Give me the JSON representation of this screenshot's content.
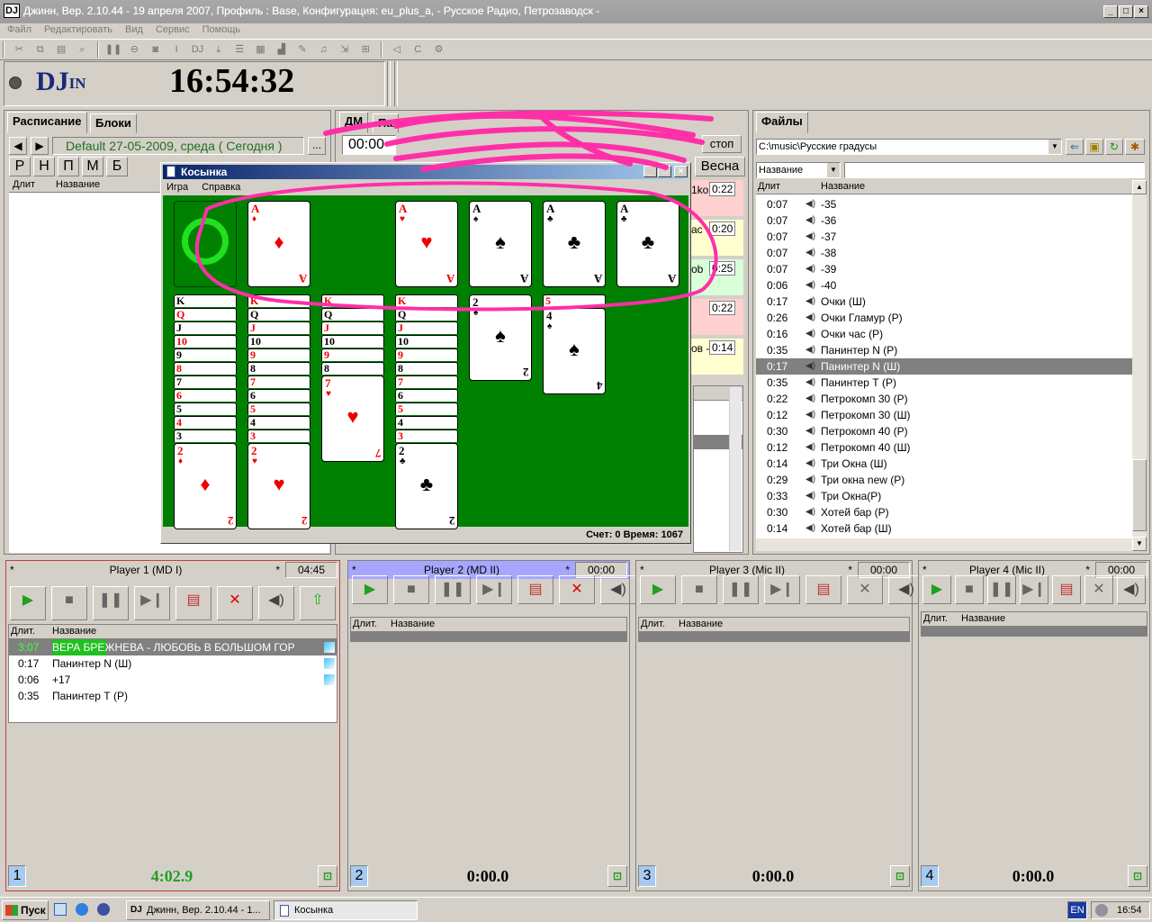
{
  "window": {
    "title": "Джинн, Вер. 2.10.44 - 19 апреля 2007, Профиль : Base, Конфигурация: eu_plus_a, - Русское Радио, Петрозаводск -",
    "app_icon": "DJ"
  },
  "menu": [
    "Файл",
    "Редактировать",
    "Вид",
    "Сервис",
    "Помощь"
  ],
  "header": {
    "logo": "DJ",
    "logo_suffix": "IN",
    "clock": "16:54:32"
  },
  "schedule": {
    "tabs": [
      "Расписание",
      "Блоки"
    ],
    "date_label": "Default 27-05-2009, среда ( Сегодня )",
    "more_button": "...",
    "letter_buttons": [
      "Р",
      "Н",
      "П",
      "М",
      "Б"
    ],
    "col_duration": "Длит",
    "col_name": "Название"
  },
  "middle": {
    "tab_dm": "ДМ",
    "tab_partial": "Па",
    "time_partial": "00:00",
    "stop_label": "стоп",
    "vesna_label": "Весна",
    "block_times": [
      "0:22",
      "0:20",
      "0:25",
      "0:22",
      "0:14"
    ],
    "block_partial": [
      "1ko",
      "ac",
      "ob",
      "",
      "ов -"
    ]
  },
  "files": {
    "tab": "Файлы",
    "path": "C:\\music\\Русские градусы",
    "sort_by": "Название",
    "col_duration": "Длит",
    "col_name": "Название",
    "rows": [
      {
        "d": "0:07",
        "n": "-35"
      },
      {
        "d": "0:07",
        "n": "-36"
      },
      {
        "d": "0:07",
        "n": "-37"
      },
      {
        "d": "0:07",
        "n": "-38"
      },
      {
        "d": "0:07",
        "n": "-39"
      },
      {
        "d": "0:06",
        "n": "-40"
      },
      {
        "d": "0:17",
        "n": "Очки (Ш)"
      },
      {
        "d": "0:26",
        "n": "Очки Гламур (Р)"
      },
      {
        "d": "0:16",
        "n": "Очки час (Р)"
      },
      {
        "d": "0:35",
        "n": "Панинтер N (Р)"
      },
      {
        "d": "0:17",
        "n": "Панинтер N (Ш)",
        "selected": true
      },
      {
        "d": "0:35",
        "n": "Панинтер Т (Р)"
      },
      {
        "d": "0:22",
        "n": "Петрокомп 30 (Р)"
      },
      {
        "d": "0:12",
        "n": "Петрокомп 30 (Ш)"
      },
      {
        "d": "0:30",
        "n": "Петрокомп 40 (Р)"
      },
      {
        "d": "0:12",
        "n": "Петрокомп 40 (Ш)"
      },
      {
        "d": "0:14",
        "n": "Три  Окна (Ш)"
      },
      {
        "d": "0:29",
        "n": "Три окна new (Р)"
      },
      {
        "d": "0:33",
        "n": "Три Окна(Р)"
      },
      {
        "d": "0:30",
        "n": "Хотей бар (Р)"
      },
      {
        "d": "0:14",
        "n": "Хотей бар (Ш)"
      }
    ]
  },
  "players": [
    {
      "num": "1",
      "title": "Player 1  (MD I)",
      "star": "*",
      "time": "04:45",
      "big_time": "4:02.9",
      "col_duration": "Длит.",
      "col_name": "Название",
      "rows": [
        {
          "d": "3:07",
          "n": "ВЕРА БРЕЖНЕВА - ЛЮБОВЬ В БОЛЬШОМ ГОР",
          "playing": true
        },
        {
          "d": "0:17",
          "n": "Панинтер N (Ш)"
        },
        {
          "d": "0:06",
          "n": "+17"
        },
        {
          "d": "0:35",
          "n": "Панинтер Т (Р)"
        }
      ]
    },
    {
      "num": "2",
      "title": "Player 2     (MD II)",
      "star": "*",
      "time": "00:00",
      "big_time": "0:00.0",
      "col_duration": "Длит.",
      "col_name": "Название",
      "rows": []
    },
    {
      "num": "3",
      "title": "Player 3     (Mic II)",
      "star": "*",
      "time": "00:00",
      "big_time": "0:00.0",
      "col_duration": "Длит.",
      "col_name": "Название",
      "rows": []
    },
    {
      "num": "4",
      "title": "Player 4     (Mic II)",
      "star": "*",
      "time": "00:00",
      "big_time": "0:00.0",
      "col_duration": "Длит.",
      "col_name": "Название",
      "rows": []
    }
  ],
  "solitaire": {
    "title": "Косынка",
    "menu": [
      "Игра",
      "Справка"
    ],
    "status": "Счет: 0 Время: 1067",
    "foundations": [
      {
        "rank": "A",
        "suit": "♦",
        "color": "red"
      },
      {
        "rank": "A",
        "suit": "♥",
        "color": "red"
      },
      {
        "rank": "A",
        "suit": "♠",
        "color": "blk"
      },
      {
        "rank": "A",
        "suit": "♣",
        "color": "blk"
      },
      {
        "rank": "A",
        "suit": "♣",
        "color": "blk"
      }
    ],
    "columns": [
      {
        "strips": [
          "K",
          "Q",
          "J",
          "10",
          "9",
          "8",
          "7",
          "6",
          "5",
          "4",
          "3"
        ],
        "stripColors": [
          "blk",
          "red",
          "blk",
          "red",
          "blk",
          "red",
          "blk",
          "red",
          "blk",
          "red",
          "blk"
        ],
        "top": {
          "rank": "2",
          "suit": "♦",
          "color": "red"
        }
      },
      {
        "strips": [
          "K",
          "Q",
          "J",
          "10",
          "9",
          "8",
          "7",
          "6",
          "5",
          "4",
          "3"
        ],
        "stripColors": [
          "red",
          "blk",
          "red",
          "blk",
          "red",
          "blk",
          "red",
          "blk",
          "red",
          "blk",
          "red"
        ],
        "top": {
          "rank": "2",
          "suit": "♥",
          "color": "red"
        }
      },
      {
        "strips": [
          "K",
          "Q",
          "J",
          "10",
          "9",
          "8"
        ],
        "stripColors": [
          "red",
          "blk",
          "red",
          "blk",
          "red",
          "blk"
        ],
        "top": {
          "rank": "7",
          "suit": "♥",
          "color": "red"
        }
      },
      {
        "strips": [
          "K",
          "Q",
          "J",
          "10",
          "9",
          "8",
          "7",
          "6",
          "5",
          "4",
          "3"
        ],
        "stripColors": [
          "red",
          "blk",
          "red",
          "blk",
          "red",
          "blk",
          "red",
          "blk",
          "red",
          "blk",
          "red"
        ],
        "top": {
          "rank": "2",
          "suit": "♣",
          "color": "blk"
        }
      },
      {
        "strips": [],
        "stripColors": [],
        "top": {
          "rank": "2",
          "suit": "♠",
          "color": "blk"
        }
      },
      {
        "strips": [
          "5"
        ],
        "stripColors": [
          "red"
        ],
        "top": {
          "rank": "4",
          "suit": "♠",
          "color": "blk"
        }
      }
    ]
  },
  "taskbar": {
    "start": "Пуск",
    "tasks": [
      "Джинн, Вер. 2.10.44 - 1...",
      "Косынка"
    ],
    "lang": "EN",
    "clock": "16:54"
  },
  "colors": {
    "felt": "#008000",
    "annotation": "#ff2fa8",
    "playing": "#00c000",
    "player_header_blue": "#a6a6ff"
  }
}
